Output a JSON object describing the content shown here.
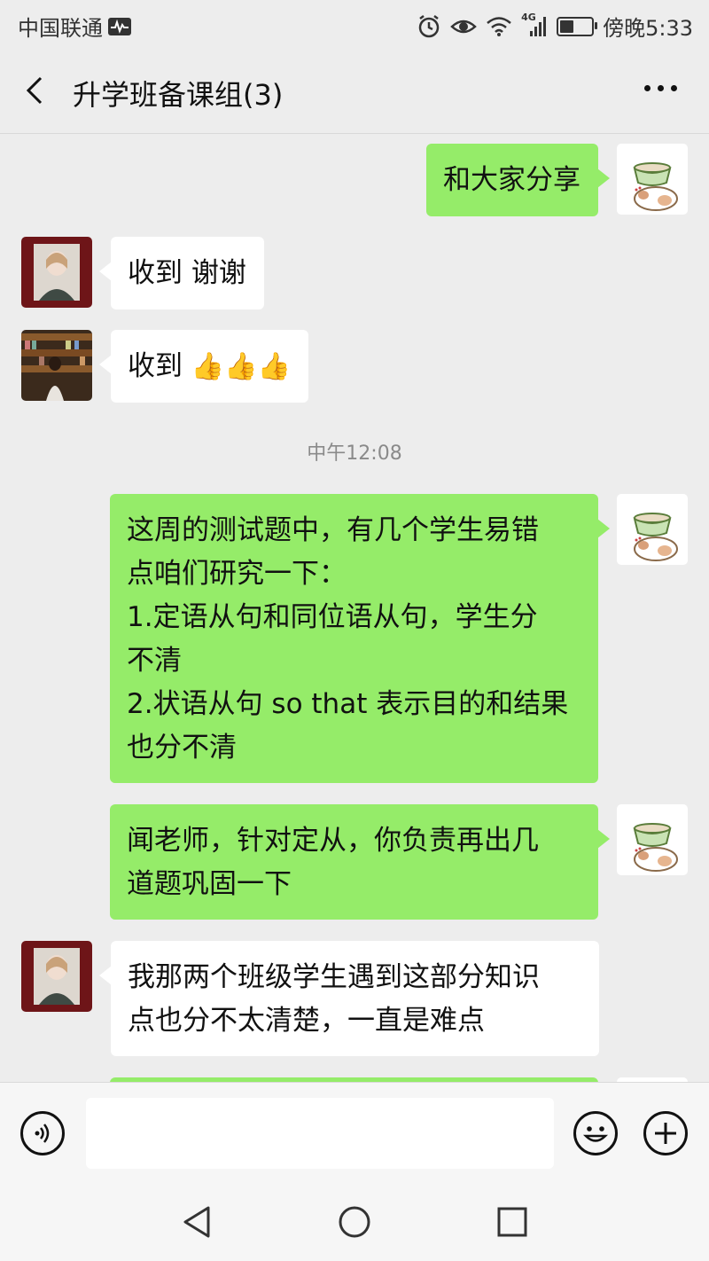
{
  "status_bar": {
    "carrier": "中国联通",
    "network": "4G",
    "time": "傍晚5:33",
    "battery_level": 0.45
  },
  "header": {
    "title": "升学班备课组(3)"
  },
  "messages": [
    {
      "sender": "me",
      "text": "和大家分享"
    },
    {
      "sender": "other-1",
      "text": "收到 谢谢"
    },
    {
      "sender": "other-2",
      "text": "收到",
      "emoji": "👍👍👍"
    },
    {
      "type": "timestamp",
      "text": "中午12:08"
    },
    {
      "sender": "me",
      "text": "这周的测试题中，有几个学生易错\n点咱们研究一下：\n1.定语从句和同位语从句，学生分\n不清\n2.状语从句 so that 表示目的和结果\n也分不清"
    },
    {
      "sender": "me",
      "text": "闻老师，针对定从，你负责再出几\n道题巩固一下"
    },
    {
      "sender": "other-1",
      "text": "我那两个班级学生遇到这部分知识\n点也分不太清楚，一直是难点"
    }
  ],
  "input": {
    "value": ""
  },
  "colors": {
    "own_bubble": "#95ec69",
    "other_bubble": "#ffffff",
    "background": "#ededed"
  },
  "icons": [
    "signal-pulse-icon",
    "alarm-icon",
    "eye-icon",
    "wifi-icon",
    "cell-signal-icon",
    "battery-icon",
    "back-arrow-icon",
    "more-icon",
    "voice-icon",
    "emoji-icon",
    "plus-icon",
    "nav-back-icon",
    "nav-home-icon",
    "nav-recents-icon"
  ]
}
